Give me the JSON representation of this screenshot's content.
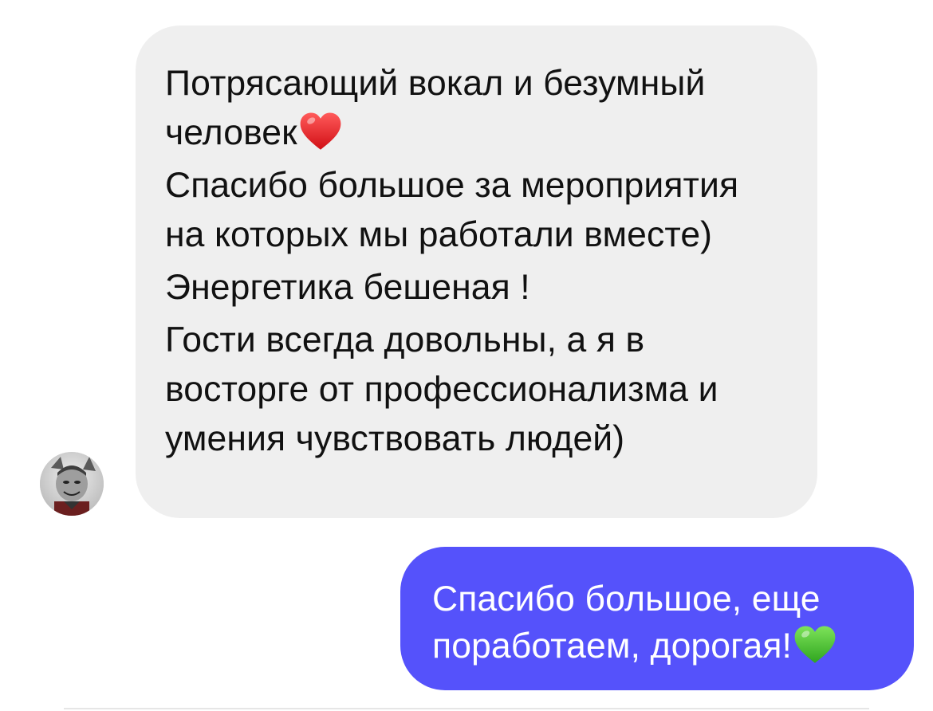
{
  "conversation": {
    "incoming": {
      "avatar_icon": "user-avatar-icon",
      "bubble_color": "#efefef",
      "lines": {
        "p1_text": "Потрясающий вокал и безумный человек",
        "p1_emoji": "red-heart-icon",
        "p2": "Спасибо большое за мероприятия на которых мы работали вместе)",
        "p3": "Энергетика бешеная !",
        "p4": "Гости всегда довольны, а я в восторге от профессионализма и умения чувствовать людей)"
      }
    },
    "outgoing": {
      "bubble_color": "#5552fb",
      "text": "Спасибо большое, еще поработаем, дорогая!",
      "emoji": "green-heart-icon"
    }
  }
}
